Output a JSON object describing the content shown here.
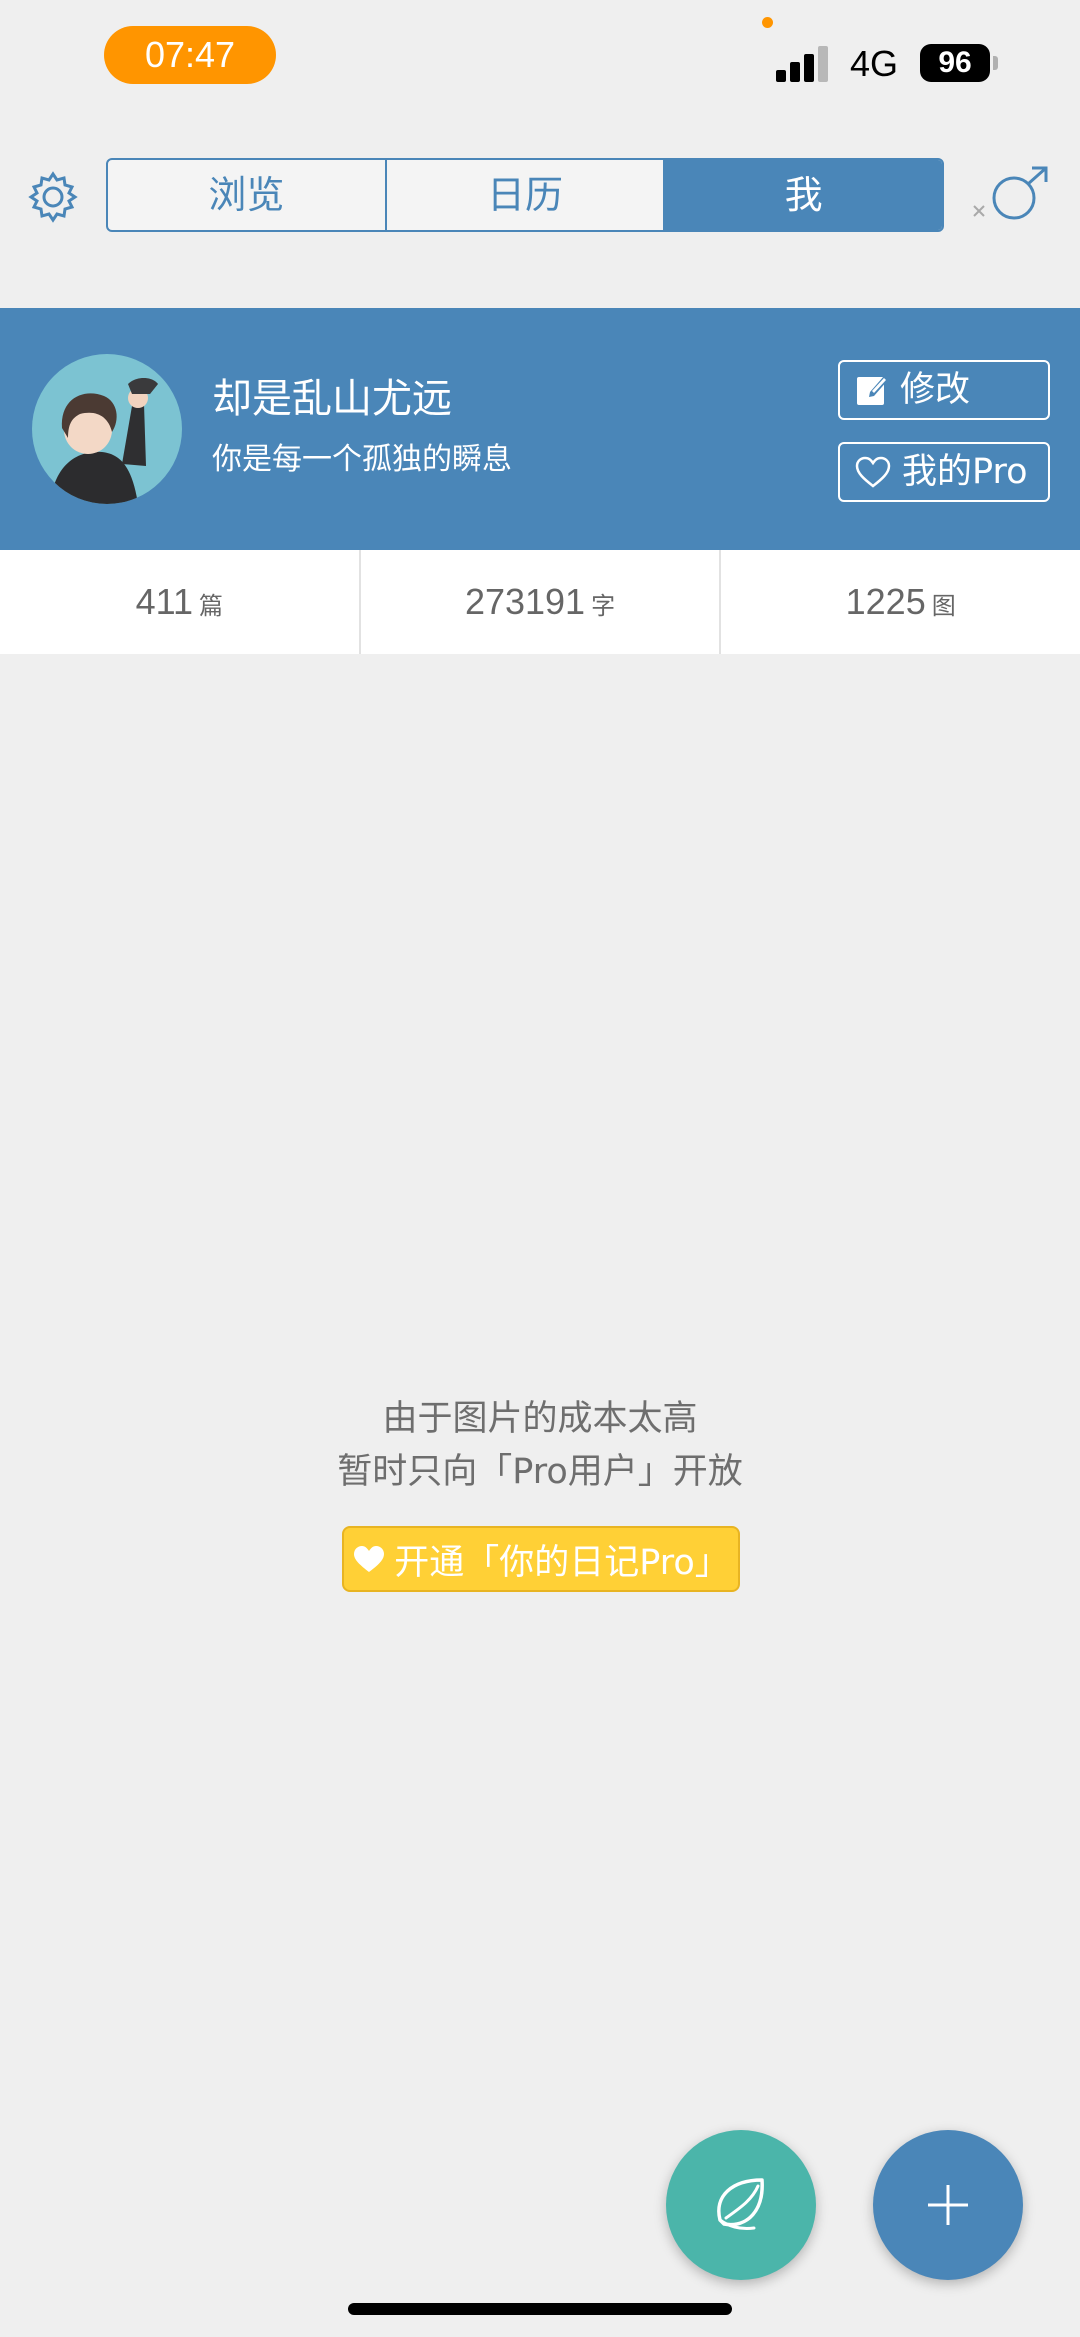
{
  "status_bar": {
    "time": "07:47",
    "network": "4G",
    "battery": "96"
  },
  "nav": {
    "tabs": [
      {
        "label": "浏览"
      },
      {
        "label": "日历"
      },
      {
        "label": "我",
        "active": true
      }
    ],
    "accent_color": "#4a86b8"
  },
  "profile": {
    "name": "却是乱山尤远",
    "bio": "你是每一个孤独的瞬息",
    "edit_label": "修改",
    "pro_label": "我的Pro",
    "banner_color": "#4a86b8"
  },
  "stats": [
    {
      "value": "411",
      "unit": "篇"
    },
    {
      "value": "273191",
      "unit": "字"
    },
    {
      "value": "1225",
      "unit": "图"
    }
  ],
  "empty_state": {
    "line1": "由于图片的成本太高",
    "line2": "暂时只向「Pro用户」开放",
    "cta_label": "开通「你的日记Pro」",
    "cta_color": "#ffd036"
  },
  "fab": {
    "leaf_color": "#4bb5aa",
    "add_color": "#4a86b8",
    "leaf_icon": "leaf-icon",
    "add_icon": "plus-icon"
  }
}
